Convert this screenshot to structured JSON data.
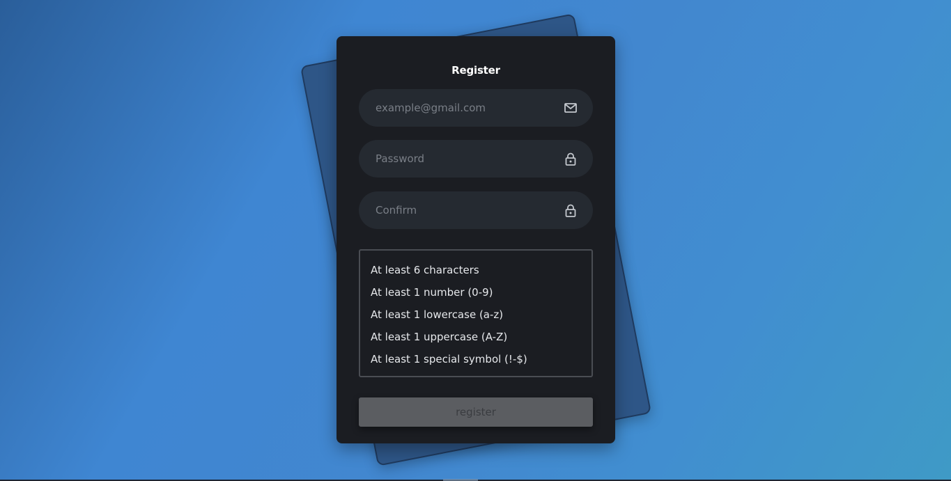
{
  "form": {
    "title": "Register",
    "email": {
      "placeholder": "example@gmail.com",
      "value": "",
      "icon": "mail-icon"
    },
    "password": {
      "placeholder": "Password",
      "value": "",
      "icon": "lock-icon"
    },
    "confirm": {
      "placeholder": "Confirm",
      "value": "",
      "icon": "lock-icon"
    },
    "rules": [
      "At least 6 characters",
      "At least 1 number (0-9)",
      "At least 1 lowercase (a-z)",
      "At least 1 uppercase (A-Z)",
      "At least 1 special symbol (!-$)"
    ],
    "submit_label": "register"
  },
  "colors": {
    "card_bg": "#1b1d22",
    "field_bg": "#252a31",
    "button_disabled": "#5b5d61",
    "accent_blue": "#4287cf"
  }
}
